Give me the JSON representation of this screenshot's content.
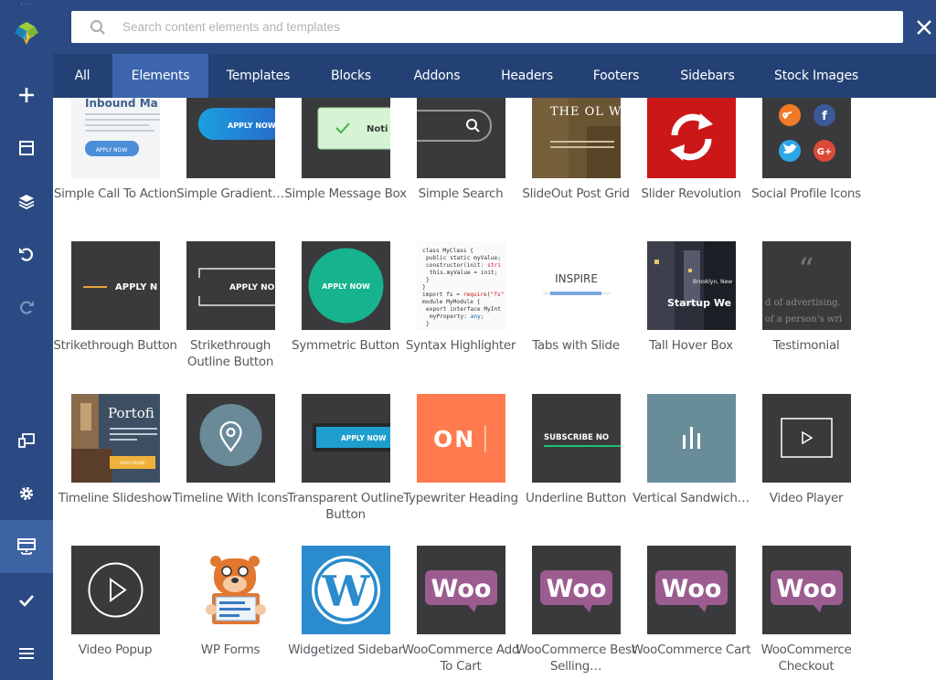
{
  "search": {
    "placeholder": "Search content elements and templates"
  },
  "navbar": {
    "items": [
      {
        "icon": "logo-icon"
      },
      {
        "icon": "plus-icon"
      },
      {
        "icon": "layout-icon"
      },
      {
        "icon": "layers-icon"
      },
      {
        "icon": "undo-icon"
      },
      {
        "icon": "redo-icon"
      },
      {
        "icon": "devices-icon"
      },
      {
        "icon": "gear-icon"
      },
      {
        "icon": "frontend-editor-icon"
      },
      {
        "icon": "check-icon"
      },
      {
        "icon": "menu-icon"
      }
    ]
  },
  "tabs": [
    "All",
    "Elements",
    "Templates",
    "Blocks",
    "Addons",
    "Headers",
    "Footers",
    "Sidebars",
    "Stock Images"
  ],
  "active_tab": "Elements",
  "elements": [
    {
      "label": "Simple Call To Action",
      "thumb_text": "Inbound Ma",
      "thumb_sub": "APPLY NOW"
    },
    {
      "label": "Simple Gradient…",
      "thumb_text": "APPLY NOW"
    },
    {
      "label": "Simple Message Box",
      "thumb_text": "Noti"
    },
    {
      "label": "Simple Search"
    },
    {
      "label": "SlideOut Post Grid",
      "thumb_text": "THE OL WEST N"
    },
    {
      "label": "Slider Revolution"
    },
    {
      "label": "Social Profile Icons"
    },
    {
      "label": "Strikethrough Button",
      "thumb_text": "APPLY N"
    },
    {
      "label": "Strikethrough Outline Button",
      "thumb_text": "APPLY NO"
    },
    {
      "label": "Symmetric Button",
      "thumb_text": "APPLY NOW"
    },
    {
      "label": "Syntax Highlighter"
    },
    {
      "label": "Tabs with Slide",
      "thumb_text": "INSPIRE"
    },
    {
      "label": "Tall Hover Box",
      "thumb_text": "Startup We"
    },
    {
      "label": "Testimonial"
    },
    {
      "label": "Timeline Slideshow",
      "thumb_text": "Portofi"
    },
    {
      "label": "Timeline With Icons"
    },
    {
      "label": "Transparent Outline Button",
      "thumb_text": "APPLY NOW"
    },
    {
      "label": "Typewriter Heading",
      "thumb_text": "ON"
    },
    {
      "label": "Underline Button",
      "thumb_text": "SUBSCRIBE NO"
    },
    {
      "label": "Vertical Sandwich…"
    },
    {
      "label": "Video Player"
    },
    {
      "label": "Video Popup"
    },
    {
      "label": "WP Forms"
    },
    {
      "label": "Widgetized Sidebar"
    },
    {
      "label": "WooCommerce Add To Cart",
      "thumb_text": "Woo"
    },
    {
      "label": "WooCommerce Best Selling…",
      "thumb_text": "Woo"
    },
    {
      "label": "WooCommerce Cart",
      "thumb_text": "Woo"
    },
    {
      "label": "WooCommerce Checkout",
      "thumb_text": "Woo"
    }
  ],
  "colors": {
    "navbar": "#2b4a83",
    "tabbar": "#244175",
    "active_tab": "#3c65ad",
    "woo_purple": "#9b5c8f",
    "tile_dark": "#3a3a3d"
  }
}
